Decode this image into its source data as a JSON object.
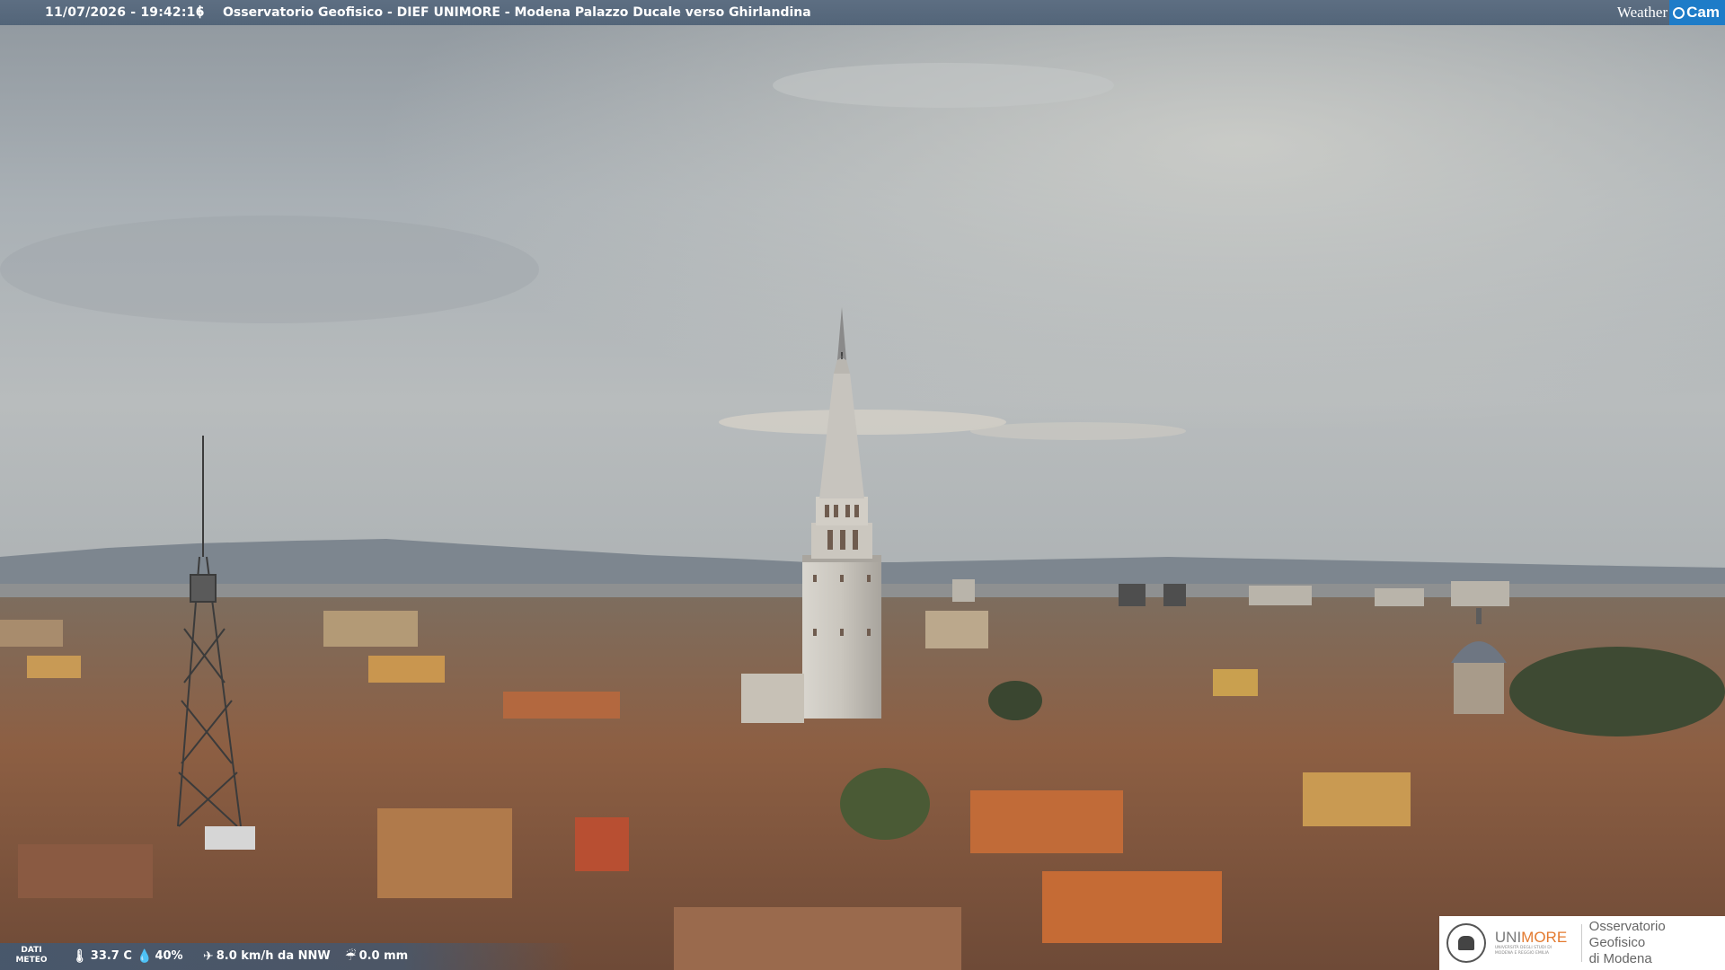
{
  "header": {
    "timestamp": "11/07/2026 - 19:42:16",
    "separator": "|",
    "title": "Osservatorio Geofisico - DIEF UNIMORE - Modena Palazzo Ducale verso Ghirlandina",
    "brand_word": "Weather",
    "brand_cam": "Cam"
  },
  "meteo": {
    "label_line1": "DATI",
    "label_line2": "METEO",
    "temperature": "33.7 C",
    "humidity": "40%",
    "wind": "8.0 km/h da NNW",
    "rain": "0.0 mm",
    "icons": [
      "thermometer-icon",
      "humidity-drop-icon",
      "wind-icon",
      "rain-gauge-icon"
    ]
  },
  "logo": {
    "uni_part1": "UNI",
    "uni_part2": "MORE",
    "uni_sub1": "UNIVERSITÀ DEGLI STUDI DI",
    "uni_sub2": "MODENA E REGGIO EMILIA",
    "obs_line1": "Osservatorio Geofisico",
    "obs_line2": "di Modena"
  },
  "colors": {
    "topbar": "#5d6e82",
    "cam_badge": "#1e7cc8",
    "unimore_orange": "#e37a2f"
  }
}
